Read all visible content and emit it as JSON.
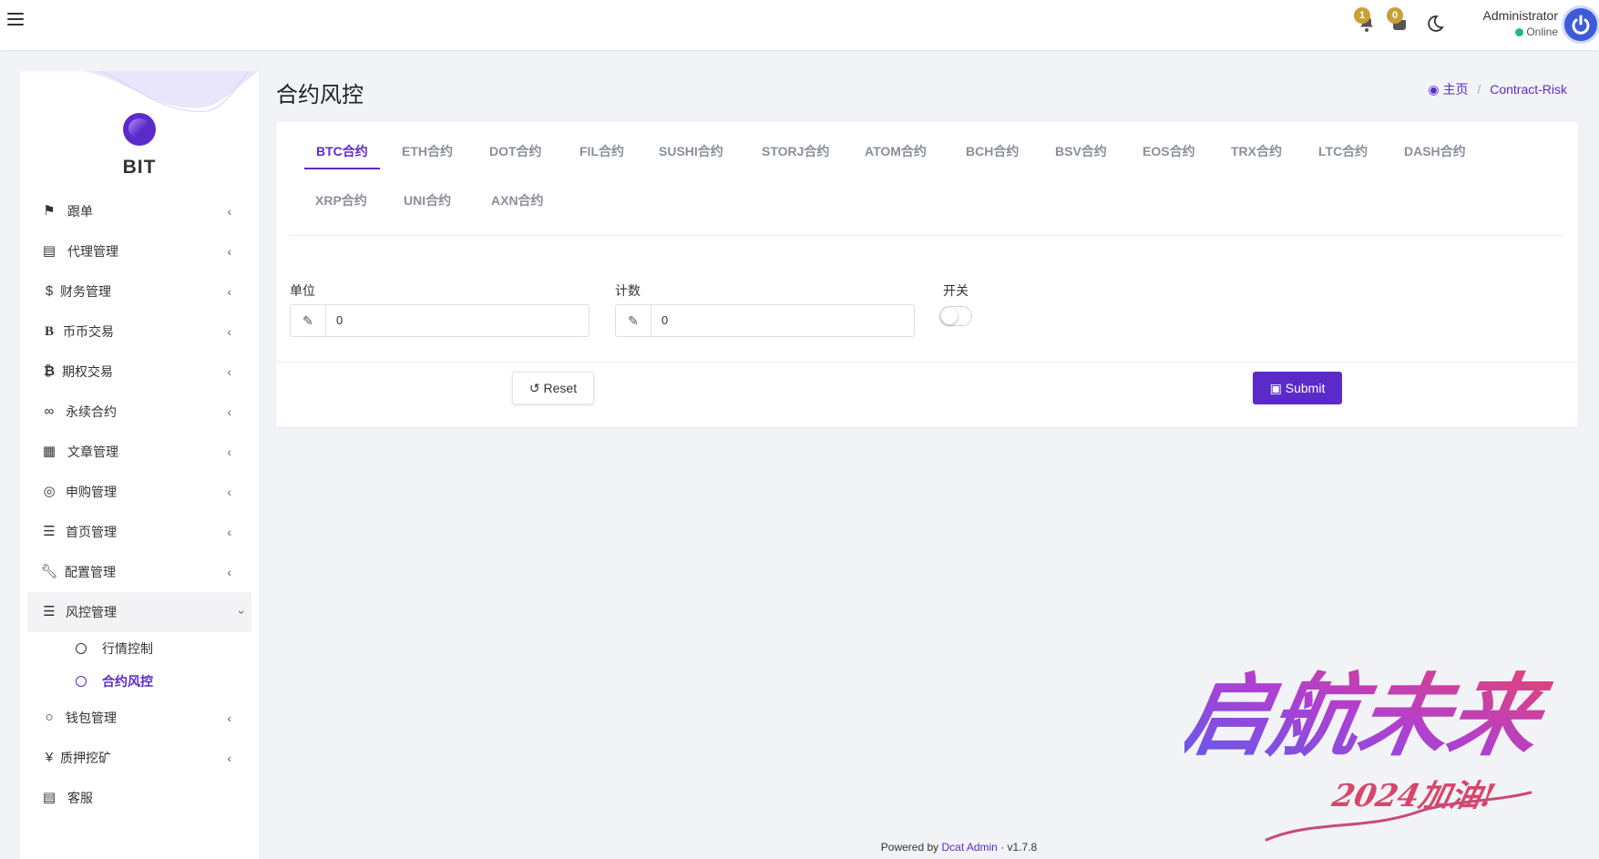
{
  "navbar": {
    "notifications_count": "1",
    "messages_count": "0",
    "user_name": "Administrator",
    "user_status": "Online"
  },
  "sidebar": {
    "brand": "BIT",
    "items": [
      {
        "label": "跟单",
        "icon": "flag-icon"
      },
      {
        "label": "代理管理",
        "icon": "id-card-icon"
      },
      {
        "label": "财务管理",
        "icon": "dollar-icon"
      },
      {
        "label": "币币交易",
        "icon": "bold-b-icon"
      },
      {
        "label": "期权交易",
        "icon": "bitcoin-icon"
      },
      {
        "label": "永续合约",
        "icon": "link-icon"
      },
      {
        "label": "文章管理",
        "icon": "newspaper-icon"
      },
      {
        "label": "申购管理",
        "icon": "lifebuoy-icon"
      },
      {
        "label": "首页管理",
        "icon": "list-icon"
      },
      {
        "label": "配置管理",
        "icon": "wrench-icon"
      },
      {
        "label": "风控管理",
        "icon": "indent-icon"
      },
      {
        "label": "钱包管理",
        "icon": "circle-icon"
      },
      {
        "label": "质押挖矿",
        "icon": "yen-icon"
      },
      {
        "label": "客服",
        "icon": "id-card-icon"
      }
    ],
    "sub_items": [
      {
        "label": "行情控制"
      },
      {
        "label": "合约风控"
      }
    ]
  },
  "page": {
    "title": "合约风控",
    "breadcrumb_home": "主页",
    "breadcrumb_current": "Contract-Risk"
  },
  "tabs": [
    "BTC合约",
    "ETH合约",
    "DOT合约",
    "FIL合约",
    "SUSHI合约",
    "STORJ合约",
    "ATOM合约",
    "BCH合约",
    "BSV合约",
    "EOS合约",
    "TRX合约",
    "LTC合约",
    "DASH合约",
    "XRP合约",
    "UNI合约",
    "AXN合约"
  ],
  "form": {
    "unit_label": "单位",
    "unit_value": "0",
    "count_label": "计数",
    "count_value": "0",
    "switch_label": "开关",
    "switch_on": false,
    "reset_label": "Reset",
    "submit_label": "Submit"
  },
  "footer": {
    "prefix": "Powered by",
    "link": "Dcat Admin",
    "sep": "·",
    "version": "v1.7.8"
  },
  "watermark": {
    "main": "启航未来",
    "sub": "2024加油!"
  },
  "colors": {
    "accent": "#5b2bc9",
    "badge": "#c8a036",
    "online": "#21b978"
  }
}
